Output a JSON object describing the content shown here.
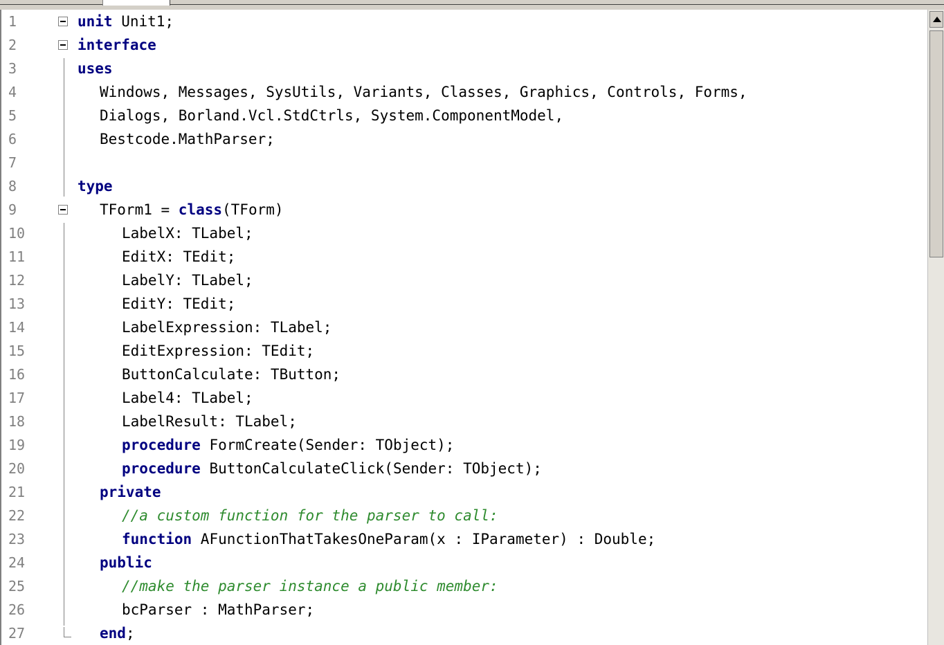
{
  "editor": {
    "lines": [
      {
        "n": "1",
        "fold": true,
        "indent": 0,
        "segs": [
          [
            "kw",
            "unit"
          ],
          [
            "",
            " Unit1;"
          ]
        ]
      },
      {
        "n": "2",
        "fold": true,
        "indent": 0,
        "segs": [
          [
            "kw",
            "interface"
          ]
        ]
      },
      {
        "n": "3",
        "indent": 0,
        "segs": [
          [
            "kw",
            "uses"
          ]
        ]
      },
      {
        "n": "4",
        "indent": 2,
        "segs": [
          [
            "",
            "Windows, Messages, SysUtils, Variants, Classes, Graphics, Controls, Forms,"
          ]
        ]
      },
      {
        "n": "5",
        "indent": 2,
        "segs": [
          [
            "",
            "Dialogs, Borland.Vcl.StdCtrls, System.ComponentModel,"
          ]
        ]
      },
      {
        "n": "6",
        "indent": 2,
        "segs": [
          [
            "",
            "Bestcode.MathParser;"
          ]
        ]
      },
      {
        "n": "7",
        "indent": 0,
        "segs": []
      },
      {
        "n": "8",
        "indent": 0,
        "segs": [
          [
            "kw",
            "type"
          ]
        ]
      },
      {
        "n": "9",
        "fold": true,
        "indent": 2,
        "segs": [
          [
            "",
            "TForm1 = "
          ],
          [
            "kw",
            "class"
          ],
          [
            "",
            "(TForm)"
          ]
        ]
      },
      {
        "n": "10",
        "indent": 4,
        "segs": [
          [
            "",
            "LabelX: TLabel;"
          ]
        ]
      },
      {
        "n": "11",
        "indent": 4,
        "segs": [
          [
            "",
            "EditX: TEdit;"
          ]
        ]
      },
      {
        "n": "12",
        "indent": 4,
        "segs": [
          [
            "",
            "LabelY: TLabel;"
          ]
        ]
      },
      {
        "n": "13",
        "indent": 4,
        "segs": [
          [
            "",
            "EditY: TEdit;"
          ]
        ]
      },
      {
        "n": "14",
        "indent": 4,
        "segs": [
          [
            "",
            "LabelExpression: TLabel;"
          ]
        ]
      },
      {
        "n": "15",
        "indent": 4,
        "segs": [
          [
            "",
            "EditExpression: TEdit;"
          ]
        ]
      },
      {
        "n": "16",
        "indent": 4,
        "segs": [
          [
            "",
            "ButtonCalculate: TButton;"
          ]
        ]
      },
      {
        "n": "17",
        "indent": 4,
        "segs": [
          [
            "",
            "Label4: TLabel;"
          ]
        ]
      },
      {
        "n": "18",
        "indent": 4,
        "segs": [
          [
            "",
            "LabelResult: TLabel;"
          ]
        ]
      },
      {
        "n": "19",
        "indent": 4,
        "segs": [
          [
            "kw",
            "procedure"
          ],
          [
            "",
            " FormCreate(Sender: TObject);"
          ]
        ]
      },
      {
        "n": "20",
        "indent": 4,
        "segs": [
          [
            "kw",
            "procedure"
          ],
          [
            "",
            " ButtonCalculateClick(Sender: TObject);"
          ]
        ]
      },
      {
        "n": "21",
        "indent": 2,
        "segs": [
          [
            "kw",
            "private"
          ]
        ]
      },
      {
        "n": "22",
        "indent": 4,
        "segs": [
          [
            "cm",
            "//a custom function for the parser to call:"
          ]
        ]
      },
      {
        "n": "23",
        "indent": 4,
        "segs": [
          [
            "kw",
            "function"
          ],
          [
            "",
            " AFunctionThatTakesOneParam(x : IParameter) : Double;"
          ]
        ]
      },
      {
        "n": "24",
        "indent": 2,
        "segs": [
          [
            "kw",
            "public"
          ]
        ]
      },
      {
        "n": "25",
        "indent": 4,
        "segs": [
          [
            "cm",
            "//make the parser instance a public member:"
          ]
        ]
      },
      {
        "n": "26",
        "indent": 4,
        "segs": [
          [
            "",
            "bcParser : MathParser;"
          ]
        ]
      },
      {
        "n": "27",
        "foldEnd": true,
        "indent": 2,
        "segs": [
          [
            "kw",
            "end"
          ],
          [
            "",
            ";"
          ]
        ]
      }
    ]
  }
}
